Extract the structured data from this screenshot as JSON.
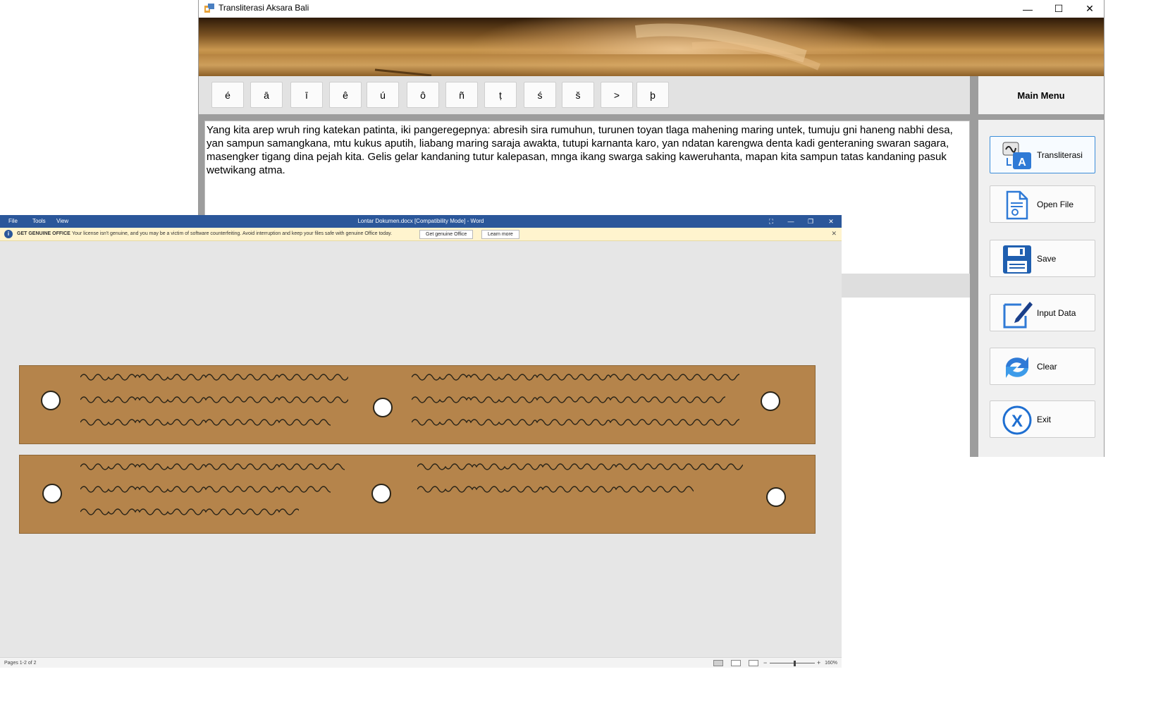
{
  "app": {
    "title": "Transliterasi Aksara Bali",
    "window_controls": {
      "minimize": "—",
      "maximize": "☐",
      "close": "✕"
    },
    "char_buttons": [
      "é",
      "ā",
      "ī",
      "ê",
      "ú",
      "ô",
      "ñ",
      "ṭ",
      "ś",
      "š",
      ">",
      "þ"
    ],
    "input_text": "Yang kita arep wruh ring katekan patinta, iki pangeregepnya: abresih sira rumuhun, turunen toyan tlaga mahening maring untek, tumuju gni haneng nabhi desa, yan sampun samangkana, mtu kukus aputih, liabang maring saraja awakta, tutupi karnanta karo, yan ndatan karengwa denta kadi genteraning swaran sagara, masengker tigang dina pejah kita. Gelis gelar kandaning tutur kalepasan, mnga ikang swarga saking kaweruhanta, mapan kita sampun tatas kandaning pasuk wetwikang atma.",
    "menu": {
      "title": "Main Menu",
      "items": [
        {
          "label": "Transliterasi",
          "icon": "transliterate-icon"
        },
        {
          "label": "Open File",
          "icon": "file-icon"
        },
        {
          "label": "Save",
          "icon": "save-icon"
        },
        {
          "label": "Input Data",
          "icon": "edit-icon"
        },
        {
          "label": "Clear",
          "icon": "refresh-icon"
        },
        {
          "label": "Exit",
          "icon": "exit-icon"
        }
      ]
    }
  },
  "word": {
    "menus": [
      "File",
      "Tools",
      "View"
    ],
    "title": "Lontar Dokumen.docx [Compatibility Mode]  -  Word",
    "warning": {
      "heading": "GET GENUINE OFFICE",
      "message": "Your license isn't genuine, and you may be a victim of software counterfeiting. Avoid interruption and keep your files safe with genuine Office today.",
      "button_primary": "Get genuine Office",
      "button_secondary": "Learn more",
      "close": "✕"
    },
    "status": {
      "pages": "Pages 1-2 of 2",
      "zoom": "160%"
    },
    "lontar_leaves": 2,
    "colors": {
      "word_blue": "#2b579a",
      "lontar": "#b5844b",
      "script": "#2a2418"
    }
  }
}
